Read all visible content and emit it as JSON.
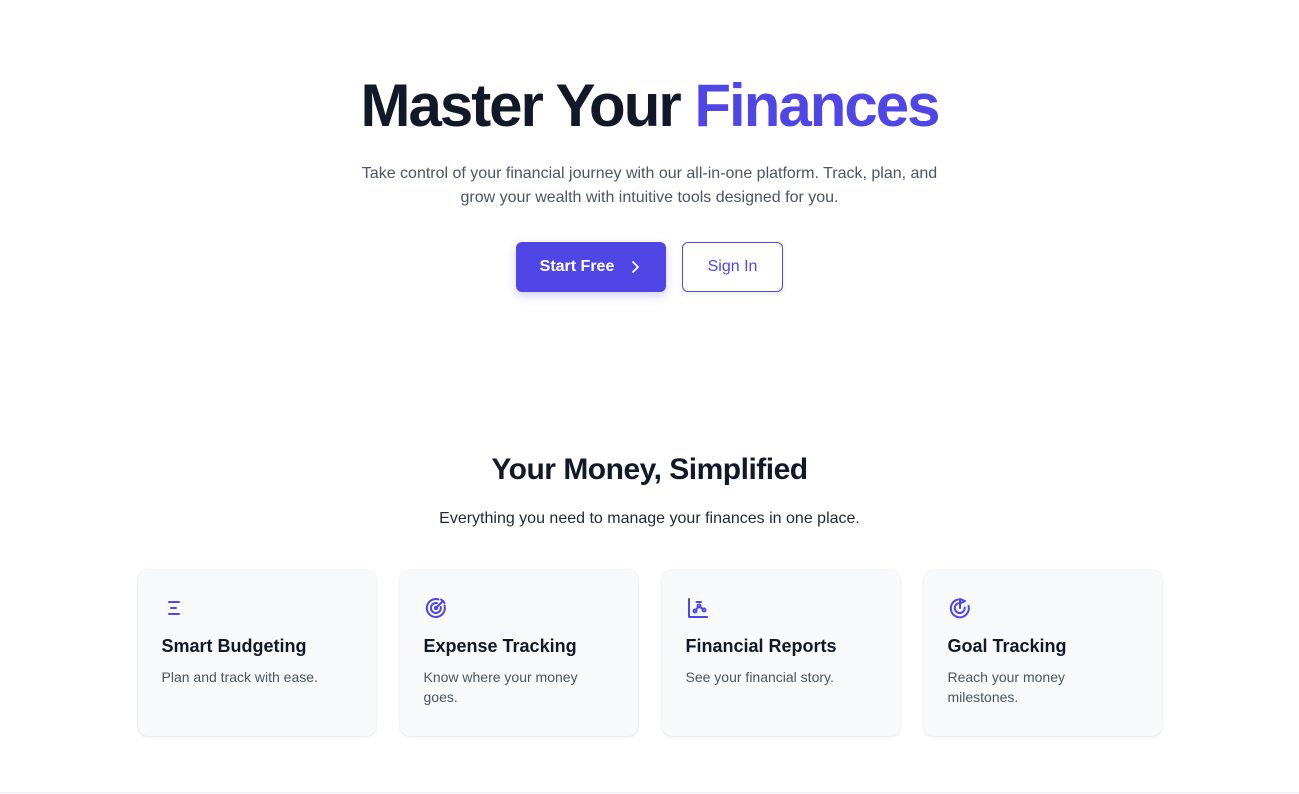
{
  "hero": {
    "title_main": "Master Your",
    "title_accent": "Finances",
    "subtitle": "Take control of your financial journey with our all-in-one platform. Track, plan, and grow your wealth with intuitive tools designed for you.",
    "primary_button": "Start Free",
    "secondary_button": "Sign In",
    "accent_color": "#4f46e5"
  },
  "features": {
    "title": "Your Money, Simplified",
    "subtitle": "Everything you need to manage your finances in one place.",
    "cards": [
      {
        "icon": "list-bars-icon",
        "title": "Smart Budgeting",
        "desc": "Plan and track with ease."
      },
      {
        "icon": "target-icon",
        "title": "Expense Tracking",
        "desc": "Know where your money goes."
      },
      {
        "icon": "chart-icon",
        "title": "Financial Reports",
        "desc": "See your financial story."
      },
      {
        "icon": "goal-icon",
        "title": "Goal Tracking",
        "desc": "Reach your money milestones."
      }
    ]
  }
}
